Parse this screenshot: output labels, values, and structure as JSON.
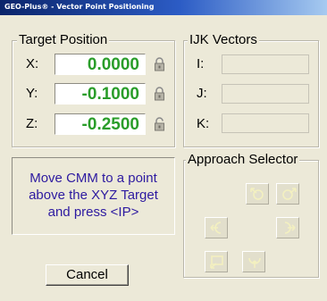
{
  "window": {
    "title": "GEO-Plus® - Vector Point Positioning",
    "colors": {
      "titlebar": "#0a246a",
      "face": "#ece9d8",
      "value_text": "#2a9d2a",
      "message_text": "#2d1aa0"
    }
  },
  "target_position": {
    "legend": "Target Position",
    "rows": [
      {
        "label": "X:",
        "value": "0.0000",
        "lock": "locked-padlock-icon"
      },
      {
        "label": "Y:",
        "value": "-0.1000",
        "lock": "locked-padlock-icon"
      },
      {
        "label": "Z:",
        "value": "-0.2500",
        "lock": "unlocked-padlock-icon"
      }
    ]
  },
  "ijk_vectors": {
    "legend": "IJK Vectors",
    "rows": [
      {
        "label": "I:",
        "value": ""
      },
      {
        "label": "J:",
        "value": ""
      },
      {
        "label": "K:",
        "value": ""
      }
    ]
  },
  "message": {
    "lines": [
      "Move CMM to a point",
      "above the XYZ Target",
      "and press <IP>"
    ]
  },
  "approach_selector": {
    "legend": "Approach Selector",
    "buttons": [
      {
        "icon": "approach-from-top-left-icon"
      },
      {
        "icon": "approach-from-top-right-icon"
      },
      {
        "icon": "approach-from-left-icon"
      },
      {
        "icon": "approach-from-right-icon"
      },
      {
        "icon": "approach-from-bottom-left-icon"
      },
      {
        "icon": "approach-from-bottom-icon"
      }
    ]
  },
  "buttons": {
    "cancel": "Cancel"
  }
}
